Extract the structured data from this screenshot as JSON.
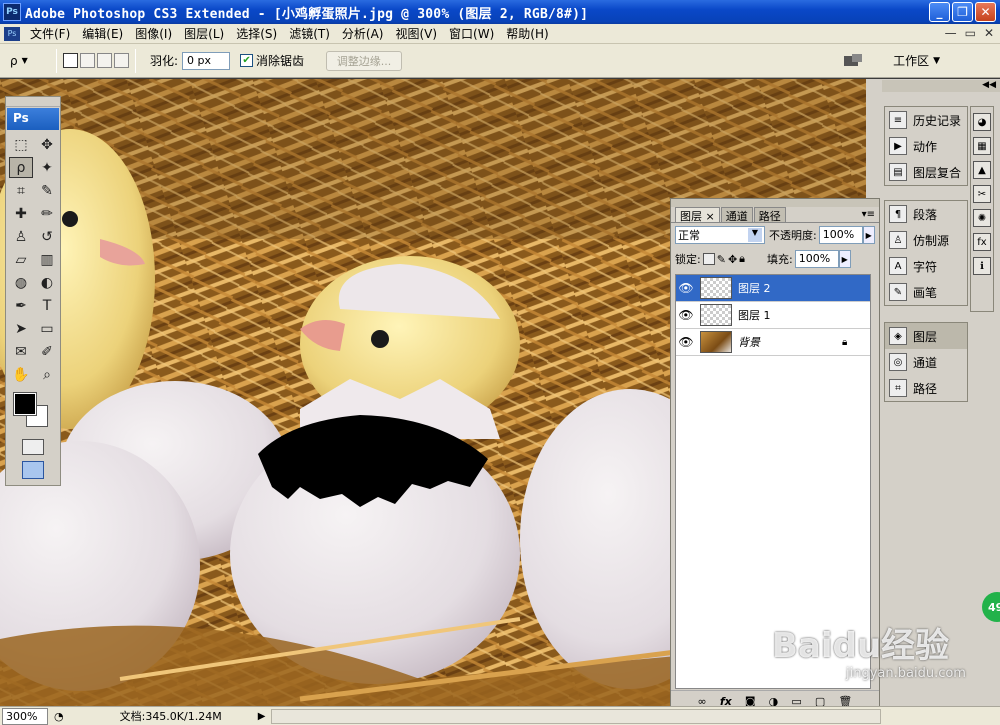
{
  "window": {
    "title": "Adobe Photoshop CS3 Extended - [小鸡孵蛋照片.jpg @ 300% (图层 2, RGB/8#)]",
    "app_icon": "Ps"
  },
  "menu": [
    "文件(F)",
    "编辑(E)",
    "图像(I)",
    "图层(L)",
    "选择(S)",
    "滤镜(T)",
    "分析(A)",
    "视图(V)",
    "窗口(W)",
    "帮助(H)"
  ],
  "options": {
    "feather_label": "羽化:",
    "feather_value": "0 px",
    "antialias_label": "消除锯齿",
    "antialias_checked": true,
    "refine_edge": "调整边缘...",
    "workspace": "工作区"
  },
  "tools_panel": {
    "badge": "Ps"
  },
  "layers_panel": {
    "tabs": [
      "图层",
      "通道",
      "路径"
    ],
    "active_tab": "图层",
    "blend_mode": "正常",
    "opacity_label": "不透明度:",
    "opacity": "100%",
    "lock_label": "锁定:",
    "fill_label": "填充:",
    "fill": "100%",
    "layers": [
      {
        "name": "图层 2",
        "selected": true
      },
      {
        "name": "图层 1",
        "selected": false
      },
      {
        "name": "背景",
        "selected": false,
        "locked": true
      }
    ],
    "footer_icons": [
      "link-icon",
      "fx-icon",
      "mask-icon",
      "adjustment-icon",
      "group-icon",
      "new-layer-icon",
      "trash-icon"
    ]
  },
  "dock": {
    "group1": [
      "历史记录",
      "动作",
      "图层复合"
    ],
    "group2": [
      "段落",
      "仿制源",
      "字符",
      "画笔"
    ],
    "group3": [
      "图层",
      "通道",
      "路径"
    ]
  },
  "status": {
    "zoom": "300%",
    "doc": "文档:345.0K/1.24M"
  },
  "badge": "49",
  "watermark": "Baidu经验",
  "watermark_sub": "jingyan.baidu.com"
}
